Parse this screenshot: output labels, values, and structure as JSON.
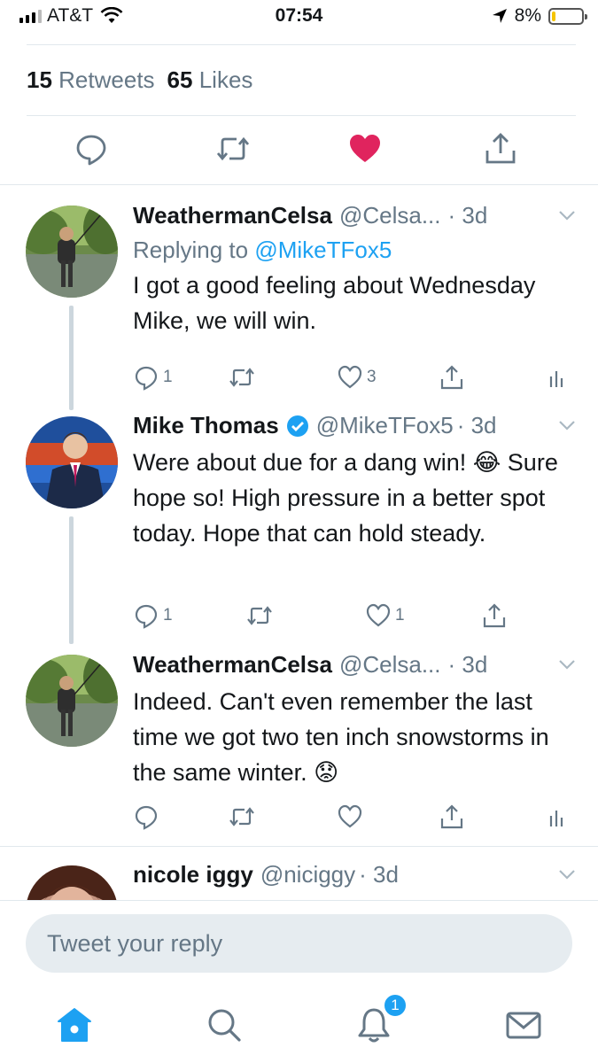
{
  "status_bar": {
    "carrier": "AT&T",
    "time": "07:54",
    "battery": "8%",
    "battery_level": 0.08
  },
  "stats": {
    "retweets_count": "15",
    "retweets_label": "Retweets",
    "likes_count": "65",
    "likes_label": "Likes"
  },
  "colors": {
    "accent": "#1da1f2",
    "like": "#e0245e",
    "muted": "#657786",
    "divider": "#e1e8ed"
  },
  "tweets": [
    {
      "name": "WeathermanCelsa",
      "handle": "@Celsa...",
      "time": "· 3d",
      "replying_prefix": "Replying to",
      "replying_mention": "@MikeTFox5",
      "text": "I got a good feeling about Wednesday Mike, we will win.",
      "replies": "1",
      "likes": "3"
    },
    {
      "name": "Mike Thomas",
      "handle": "@MikeTFox5",
      "time": "· 3d",
      "text": "Were about due for a dang win! 😂 Sure hope so! High pressure in a better spot today. Hope that can hold steady.",
      "replies": "1",
      "likes": "1"
    },
    {
      "name": "WeathermanCelsa",
      "handle": "@Celsa...",
      "time": "· 3d",
      "text": "Indeed. Can't even remember the last time we got two ten inch snowstorms in the same winter. 😟"
    },
    {
      "name": "nicole iggy",
      "handle": "@niciggy",
      "time": "· 3d"
    }
  ],
  "reply_box": {
    "placeholder": "Tweet your reply"
  },
  "tab_bar": {
    "notifications_badge": "1"
  }
}
